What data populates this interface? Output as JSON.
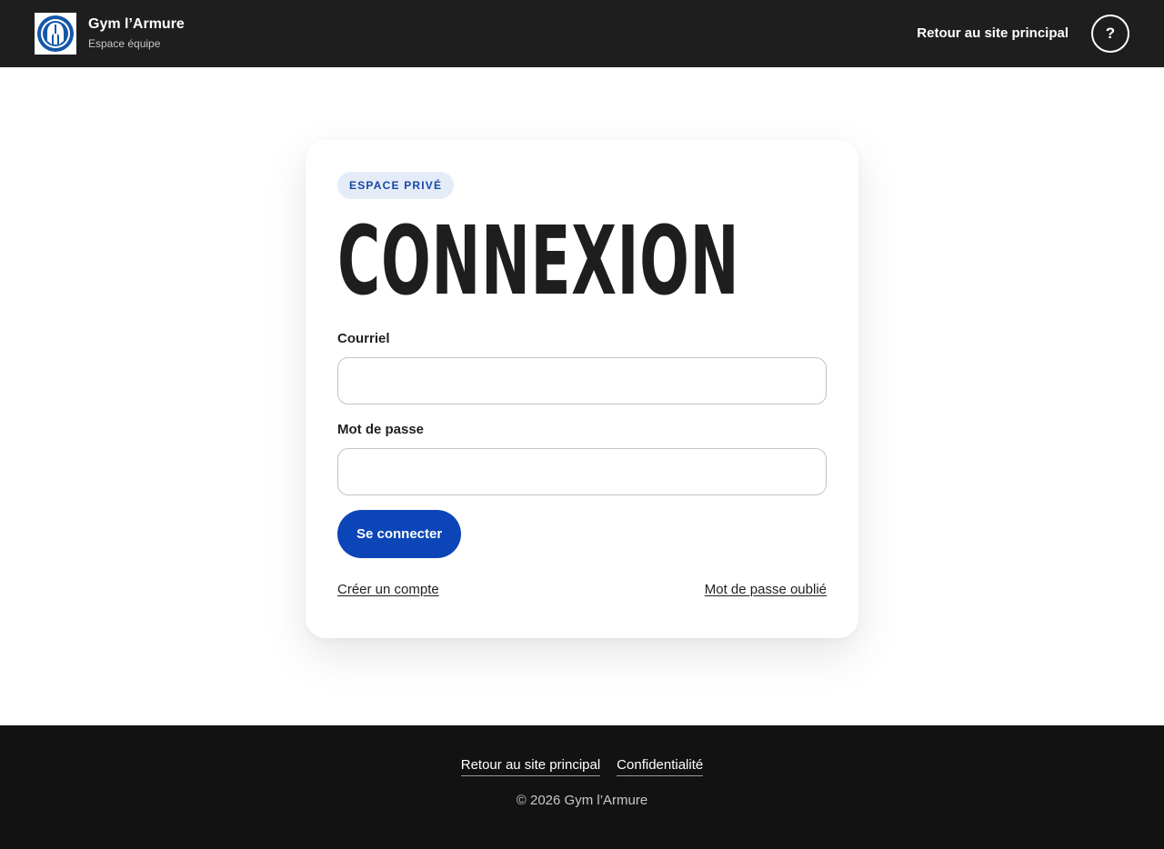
{
  "header": {
    "brand_name": "Gym l’Armure",
    "brand_sub": "Espace équipe",
    "main_site_link": "Retour au site principal",
    "help_label": "?"
  },
  "login": {
    "badge": "ESPACE PRIVÉ",
    "title": "CONNEXION",
    "email_label": "Courriel",
    "email_value": "",
    "password_label": "Mot de passe",
    "password_value": "",
    "submit_label": "Se connecter",
    "create_account_link": "Créer un compte",
    "forgot_password_link": "Mot de passe oublié"
  },
  "footer": {
    "links": [
      "Retour au site principal",
      "Confidentialité"
    ],
    "copyright": "© 2026 Gym l’Armure"
  },
  "colors": {
    "header_bg": "#1e1e1e",
    "footer_bg": "#121212",
    "accent": "#0b45b8",
    "badge_bg": "#e4ecf8",
    "badge_text": "#1747a6"
  },
  "icons": {
    "logo": "spartan-helmet-logo",
    "help": "question-mark-icon"
  }
}
